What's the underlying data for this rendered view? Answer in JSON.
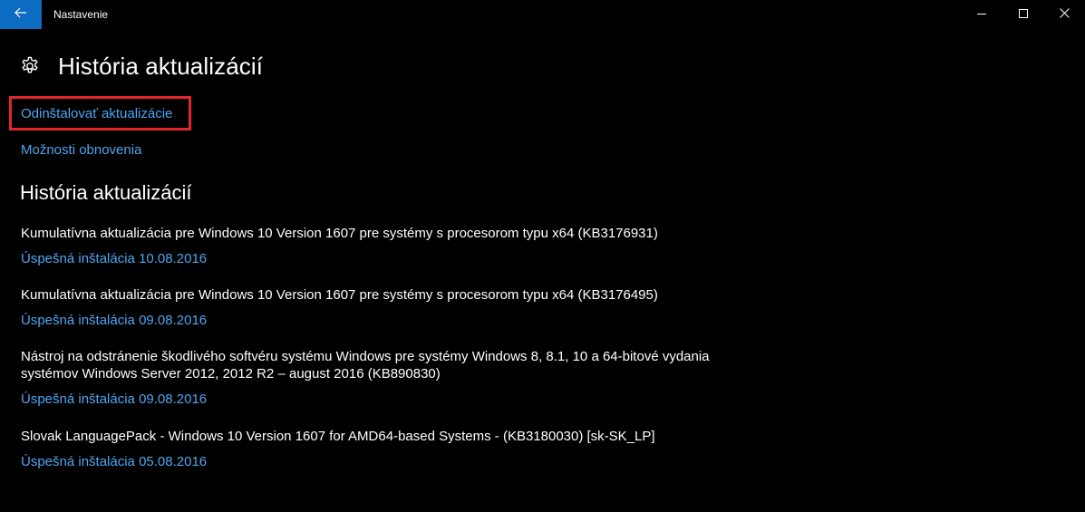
{
  "window": {
    "app_title": "Nastavenie",
    "accent_color": "#0b6cc2",
    "link_color": "#4da6f0",
    "highlight_color": "#e0252c"
  },
  "icons": {
    "back": "back-arrow-icon",
    "minimize": "minimize-icon",
    "maximize": "maximize-icon",
    "close": "close-icon",
    "settings": "gear-icon"
  },
  "header": {
    "title": "História aktualizácií"
  },
  "links": {
    "uninstall": "Odinštalovať aktualizácie",
    "recovery": "Možnosti obnovenia"
  },
  "history": {
    "section_title": "História aktualizácií",
    "items": [
      {
        "name": "Kumulatívna aktualizácia pre Windows 10 Version 1607 pre systémy s procesorom typu x64 (KB3176931)",
        "status": "Úspešná inštalácia 10.08.2016"
      },
      {
        "name": "Kumulatívna aktualizácia pre Windows 10 Version 1607 pre systémy s procesorom typu x64 (KB3176495)",
        "status": "Úspešná inštalácia 09.08.2016"
      },
      {
        "name": "Nástroj na odstránenie škodlivého softvéru systému Windows pre systémy Windows 8, 8.1, 10 a 64-bitové vydania systémov Windows Server 2012, 2012 R2 – august 2016 (KB890830)",
        "status": "Úspešná inštalácia 09.08.2016"
      },
      {
        "name": "Slovak LanguagePack - Windows 10 Version 1607 for AMD64-based Systems - (KB3180030) [sk-SK_LP]",
        "status": "Úspešná inštalácia 05.08.2016"
      }
    ]
  }
}
